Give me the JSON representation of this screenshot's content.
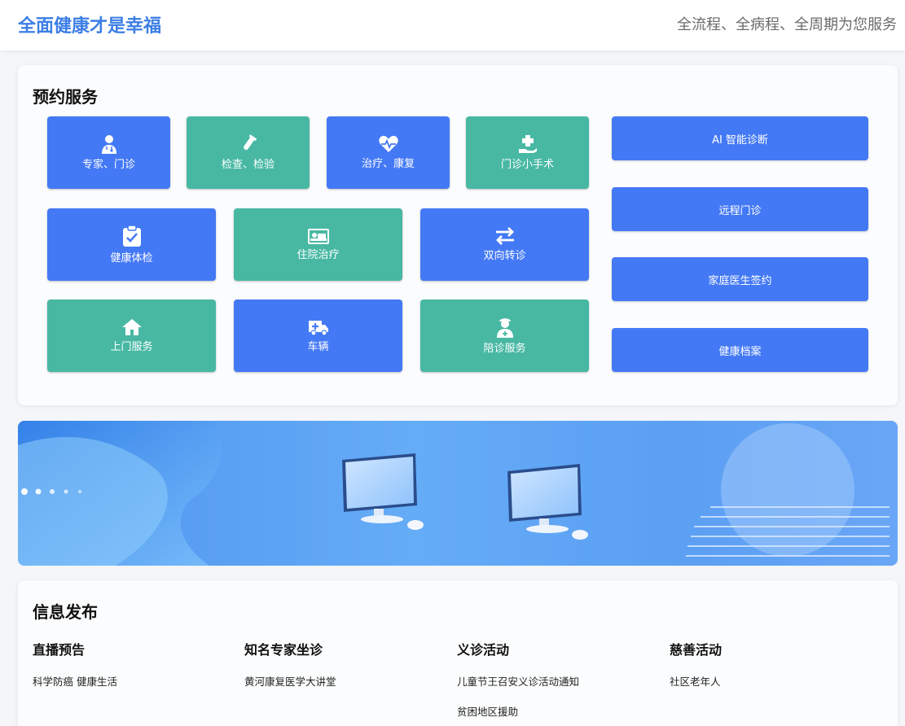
{
  "header": {
    "title": "全面健康才是幸福",
    "slogan": "全流程、全病程、全周期为您服务"
  },
  "appointment": {
    "title": "预约服务",
    "tiles": [
      {
        "label": "专家、门诊",
        "icon": "doctor-icon",
        "color": "#4479f5"
      },
      {
        "label": "检查、检验",
        "icon": "test-tube-icon",
        "color": "#48b8a3"
      },
      {
        "label": "治疗、康复",
        "icon": "heartbeat-icon",
        "color": "#4479f5"
      },
      {
        "label": "门诊小手术",
        "icon": "hand-medical-icon",
        "color": "#48b8a3"
      },
      {
        "label": "健康体检",
        "icon": "clipboard-check-icon",
        "color": "#4479f5"
      },
      {
        "label": "住院治疗",
        "icon": "hospital-bed-icon",
        "color": "#48b8a3"
      },
      {
        "label": "双向转诊",
        "icon": "arrows-exchange-icon",
        "color": "#4479f5"
      },
      {
        "label": "上门服务",
        "icon": "home-icon",
        "color": "#48b8a3"
      },
      {
        "label": "车辆",
        "icon": "ambulance-icon",
        "color": "#4479f5"
      },
      {
        "label": "陪诊服务",
        "icon": "nurse-icon",
        "color": "#48b8a3"
      }
    ],
    "side_buttons": [
      {
        "label": "AI 智能诊断"
      },
      {
        "label": "远程门诊"
      },
      {
        "label": "家庭医生签约"
      },
      {
        "label": "健康档案"
      }
    ]
  },
  "banner": {
    "illustration": "computers-banner"
  },
  "info": {
    "title": "信息发布",
    "columns": [
      {
        "title": "直播预告",
        "items": [
          "科学防癌 健康生活"
        ]
      },
      {
        "title": "知名专家坐诊",
        "items": [
          "黄河康复医学大讲堂"
        ]
      },
      {
        "title": "义诊活动",
        "items": [
          "儿童节王召安义诊活动通知",
          "贫困地区援助"
        ]
      },
      {
        "title": "慈善活动",
        "items": [
          "社区老年人"
        ]
      }
    ]
  },
  "colors": {
    "accent_blue": "#4479f5",
    "accent_teal": "#48b8a3",
    "title_blue": "#3c7ee6"
  }
}
